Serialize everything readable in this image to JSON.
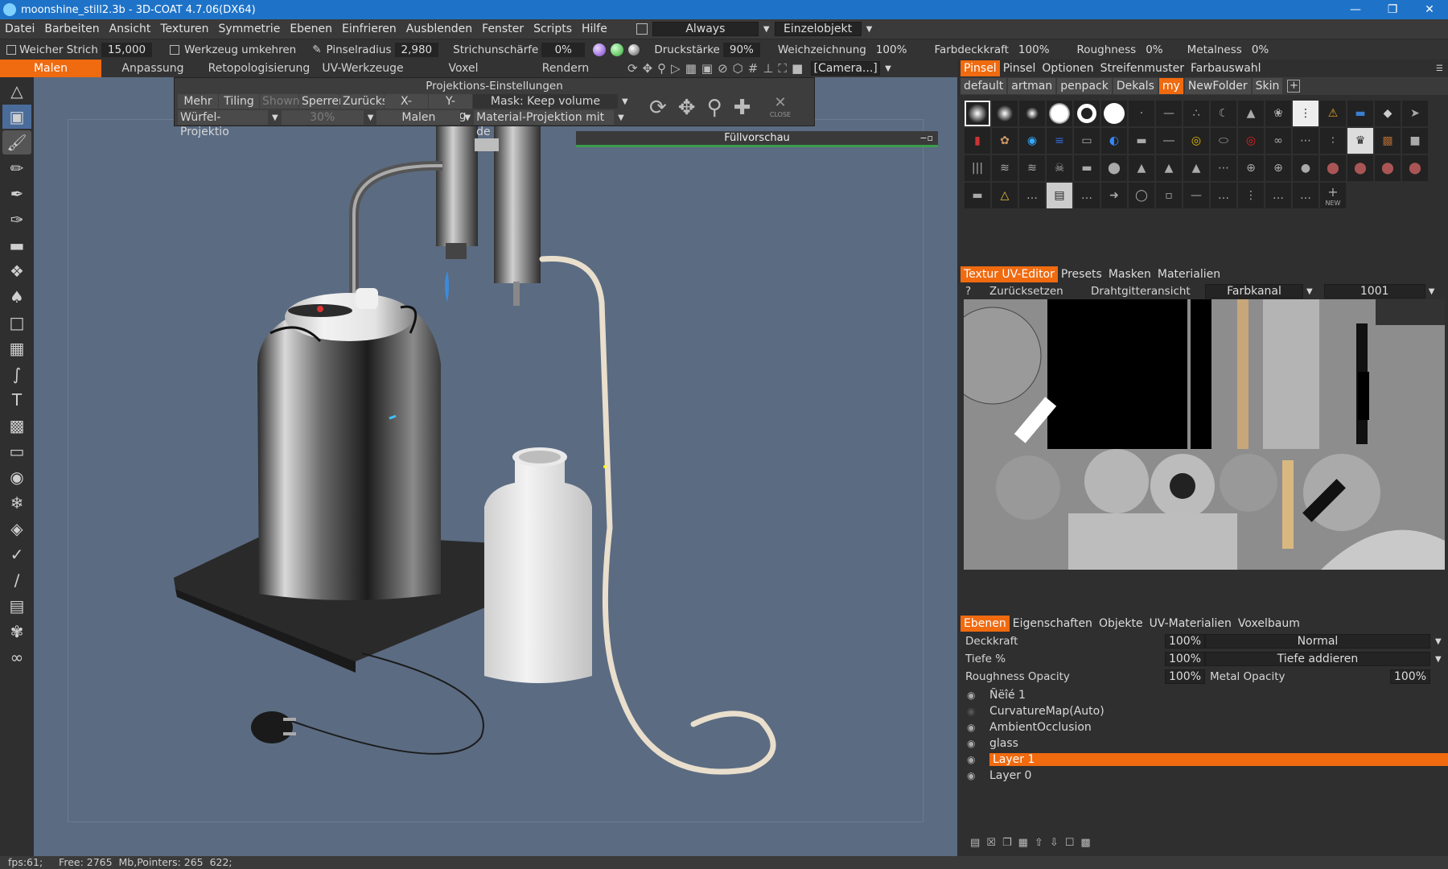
{
  "window": {
    "title": "moonshine_still2.3b - 3D-COAT 4.7.06(DX64)"
  },
  "menu": [
    "Datei",
    "Barbeiten",
    "Ansicht",
    "Texturen",
    "Symmetrie",
    "Ebenen",
    "Einfrieren",
    "Ausblenden",
    "Fenster",
    "Scripts",
    "Hilfe"
  ],
  "menu_right": {
    "always": "Always",
    "object": "Einzelobjekt"
  },
  "tooloptions": {
    "soft_stroke": "Weicher Strich",
    "soft_stroke_val": "15,000",
    "invert": "Werkzeug umkehren",
    "radius": "Pinselradius",
    "radius_val": "2,980",
    "sharpness": "Strichunschärfe",
    "sharpness_val": "0%",
    "pressure": "Druckstärke",
    "pressure_val": "90%",
    "smoothing": "Weichzeichnung",
    "smoothing_val": "100%",
    "color_op": "Farbdeckkraft",
    "color_op_val": "100%",
    "roughness": "Roughness",
    "roughness_val": "0%",
    "metalness": "Metalness",
    "metalness_val": "0%"
  },
  "modetabs": [
    "Malen",
    "Anpassung",
    "Retopologisierung",
    "UV-Werkzeuge",
    "Voxel",
    "Rendern"
  ],
  "camera": "[Camera...]",
  "projection": {
    "title": "Projektions-Einstellungen",
    "buttons": [
      "Mehr",
      "Tiling",
      "Shown",
      "Sperren",
      "Zurücks",
      "X-Spieg",
      "Y-Spieg"
    ],
    "mask": "Mask:  Keep  volume",
    "proj_mode": "Würfel-Projektio",
    "percent": "30%",
    "paint": "Malen",
    "matproj": "Material-Projektion  mit  de",
    "close": "CLOSE"
  },
  "fill_preview": "Füllvorschau",
  "brush_tabs": [
    "Pinsel",
    "Pinsel",
    "Optionen",
    "Streifenmuster",
    "Farbauswahl"
  ],
  "brush_folders": [
    "default",
    "artman",
    "penpack",
    "Dekals",
    "my",
    "NewFolder",
    "Skin"
  ],
  "brush_new": "NEW",
  "uv_tabs": [
    "Textur  UV-Editor",
    "Presets",
    "Masken",
    "Materialien"
  ],
  "uv_toolbar": {
    "help": "?",
    "reset": "Zurücksetzen",
    "wire": "Drahtgitteransicht",
    "channel": "Farbkanal",
    "udim": "1001"
  },
  "layer_tabs": [
    "Ebenen",
    "Eigenschaften",
    "Objekte",
    "UV-Materialien",
    "Voxelbaum"
  ],
  "layer_props": {
    "opacity": "Deckkraft",
    "opacity_val": "100%",
    "blend": "Normal",
    "depth": "Tiefe  %",
    "depth_val": "100%",
    "depth_mode": "Tiefe  addieren",
    "rough_op": "Roughness  Opacity",
    "rough_op_val": "100%",
    "metal_op": "Metal  Opacity",
    "metal_op_val": "100%"
  },
  "layers": [
    "Ñëîé  1",
    "CurvatureMap(Auto)",
    "AmbientOcclusion",
    "glass",
    "Layer  1",
    "Layer  0"
  ],
  "status": "fps:61;     Free: 2765  Mb,Pointers: 265  622;"
}
